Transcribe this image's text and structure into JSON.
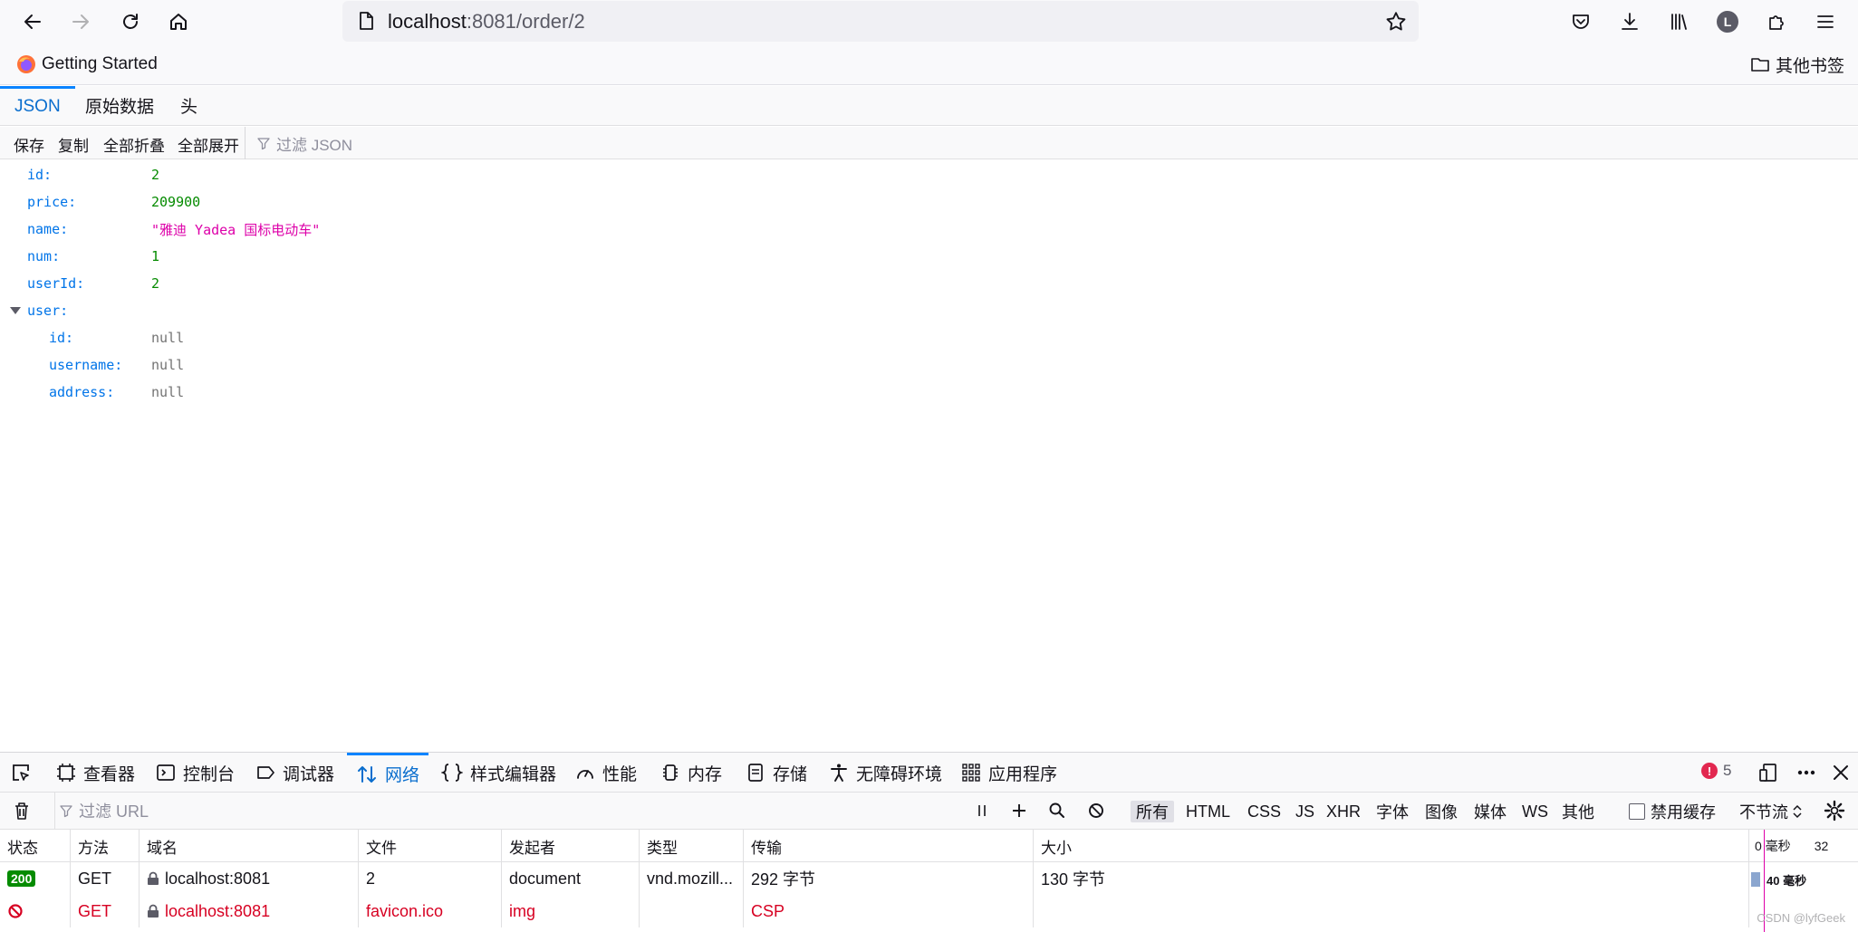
{
  "browser": {
    "url_host": "localhost",
    "url_rest": ":8081/order/2",
    "profile_initial": "L"
  },
  "bookmarks": {
    "getting_started": "Getting Started",
    "other_bookmarks": "其他书签"
  },
  "json_viewer": {
    "tabs": [
      {
        "label": "JSON",
        "active": true
      },
      {
        "label": "原始数据",
        "active": false
      },
      {
        "label": "头",
        "active": false
      }
    ],
    "toolbar": {
      "save": "保存",
      "copy": "复制",
      "collapse_all": "全部折叠",
      "expand_all": "全部展开",
      "filter_placeholder": "过滤 JSON"
    },
    "rows": [
      {
        "key": "id:",
        "value": "2",
        "type": "num"
      },
      {
        "key": "price:",
        "value": "209900",
        "type": "num"
      },
      {
        "key": "name:",
        "value": "\"雅迪 Yadea 国标电动车\"",
        "type": "str"
      },
      {
        "key": "num:",
        "value": "1",
        "type": "num"
      },
      {
        "key": "userId:",
        "value": "2",
        "type": "num"
      },
      {
        "key": "user:",
        "value": "",
        "type": "obj"
      },
      {
        "key": "id:",
        "value": "null",
        "type": "nul"
      },
      {
        "key": "username:",
        "value": "null",
        "type": "nul"
      },
      {
        "key": "address:",
        "value": "null",
        "type": "nul"
      }
    ]
  },
  "devtools": {
    "tabs": [
      {
        "label": "查看器"
      },
      {
        "label": "控制台"
      },
      {
        "label": "调试器"
      },
      {
        "label": "网络"
      },
      {
        "label": "样式编辑器"
      },
      {
        "label": "性能"
      },
      {
        "label": "内存"
      },
      {
        "label": "存储"
      },
      {
        "label": "无障碍环境"
      },
      {
        "label": "应用程序"
      }
    ],
    "error_count": "5",
    "network": {
      "filter_placeholder": "过滤 URL",
      "type_filters": [
        "所有",
        "HTML",
        "CSS",
        "JS",
        "XHR",
        "字体",
        "图像",
        "媒体",
        "WS",
        "其他"
      ],
      "disable_cache": "禁用缓存",
      "throttling": "不节流",
      "columns": [
        "状态",
        "方法",
        "域名",
        "文件",
        "发起者",
        "类型",
        "传输",
        "大小"
      ],
      "timeline_start": "0 毫秒",
      "timeline_next": "32",
      "requests": [
        {
          "status": "200",
          "method": "GET",
          "domain": "localhost:8081",
          "file": "2",
          "initiator": "document",
          "type": "vnd.mozill...",
          "transferred": "292 字节",
          "size": "130 字节",
          "timing": "40 毫秒",
          "blocked": false
        },
        {
          "status": "",
          "method": "GET",
          "domain": "localhost:8081",
          "file": "favicon.ico",
          "initiator": "img",
          "type": "",
          "transferred": "CSP",
          "size": "",
          "timing": "",
          "blocked": true
        }
      ]
    }
  },
  "watermark": "CSDN @lyfGeek"
}
